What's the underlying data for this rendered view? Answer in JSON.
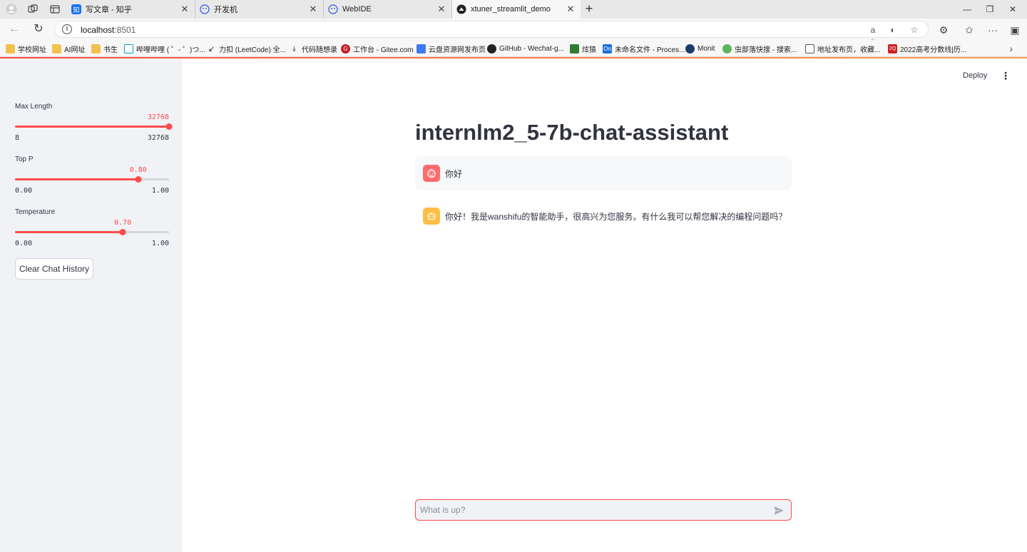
{
  "browser": {
    "tabs": [
      {
        "title": "写文章 - 知乎",
        "favicon": "zhihu-icon",
        "favicon_text": "知",
        "color": "#1772f6"
      },
      {
        "title": "开发机",
        "favicon": "internlm-icon",
        "color": "#4a6fd8"
      },
      {
        "title": "WebIDE",
        "favicon": "internlm-icon",
        "color": "#4a6fd8"
      },
      {
        "title": "xtuner_streamlit_demo",
        "favicon": "streamlit-icon",
        "color": "#222222"
      }
    ],
    "url_host": "localhost",
    "url_port": ":8501",
    "bookmarks": [
      {
        "label": "学校网址",
        "icon": "folder-icon"
      },
      {
        "label": "AI网址",
        "icon": "folder-icon"
      },
      {
        "label": "书生",
        "icon": "folder-icon"
      },
      {
        "label": "哔哩哔哩 ( ゜- ゜)つ...",
        "icon": "bilibili-icon"
      },
      {
        "label": "力扣 (LeetCode) 全...",
        "icon": "leetcode-icon"
      },
      {
        "label": "代码随想录",
        "icon": "code-icon"
      },
      {
        "label": "工作台 - Gitee.com",
        "icon": "gitee-icon",
        "icon_text": "G"
      },
      {
        "label": "云盘资源网发布页",
        "icon": "doc-icon"
      },
      {
        "label": "GitHub - Wechat-g...",
        "icon": "github-icon"
      },
      {
        "label": "炫猿",
        "icon": "xuanyuan-icon"
      },
      {
        "label": "未命名文件 - Proces...",
        "icon": "processon-icon",
        "icon_text": "On"
      },
      {
        "label": "Monit",
        "icon": "monit-icon"
      },
      {
        "label": "虫部落快搜 - 搜索...",
        "icon": "chongbuluo-icon"
      },
      {
        "label": "地址发布页，收藏...",
        "icon": "page-icon"
      },
      {
        "label": "2022高考分数线|历...",
        "icon": "gaokao-icon",
        "icon_text": "2Q"
      }
    ]
  },
  "sidebar": {
    "sliders": [
      {
        "label": "Max Length",
        "value": 32768,
        "value_text": "32768",
        "min": 8,
        "max": 32768,
        "min_text": "8",
        "max_text": "32768",
        "fraction": 1.0
      },
      {
        "label": "Top P",
        "value": 0.8,
        "value_text": "0.80",
        "min": 0,
        "max": 1,
        "min_text": "0.00",
        "max_text": "1.00",
        "fraction": 0.8
      },
      {
        "label": "Temperature",
        "value": 0.7,
        "value_text": "0.70",
        "min": 0,
        "max": 1,
        "min_text": "0.00",
        "max_text": "1.00",
        "fraction": 0.7
      }
    ],
    "clear_button": "Clear Chat History"
  },
  "header": {
    "deploy": "Deploy"
  },
  "main": {
    "title": "internlm2_5-7b-chat-assistant",
    "messages": [
      {
        "role": "user",
        "text": "你好"
      },
      {
        "role": "assistant",
        "text": "你好！我是wanshifu的智能助手，很高兴为您服务。有什么我可以帮您解决的编程问题吗？"
      }
    ],
    "input_placeholder": "What is up?"
  },
  "colors": {
    "primary": "#ff4b4b",
    "sidebar_bg": "#f0f2f6",
    "user_avatar": "#ff6c6c",
    "bot_avatar": "#ffbd45"
  }
}
